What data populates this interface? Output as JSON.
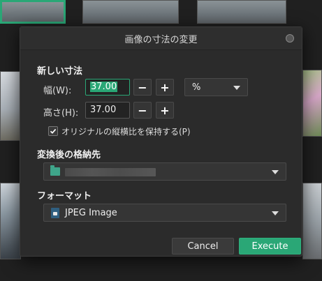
{
  "dialog": {
    "title": "画像の寸法の変更",
    "new_size_heading": "新しい寸法",
    "width_label": "幅(W):",
    "width_value": "37.00",
    "height_label": "高さ(H):",
    "height_value": "37.00",
    "unit_value": "%",
    "keep_aspect_label": "オリジナルの縦横比を保持する(P)",
    "keep_aspect_checked": true,
    "destination_heading": "変換後の格納先",
    "format_heading": "フォーマット",
    "format_value": "JPEG Image",
    "cancel_label": "Cancel",
    "execute_label": "Execute",
    "minus_glyph": "−",
    "plus_glyph": "+"
  },
  "colors": {
    "accent": "#2aa776",
    "dialog_bg": "#2b2b2b",
    "folder": "#3fa58a"
  },
  "icons": [
    "close-icon",
    "checkmark-icon",
    "folder-icon",
    "image-file-icon",
    "dropdown-arrow-icon"
  ]
}
